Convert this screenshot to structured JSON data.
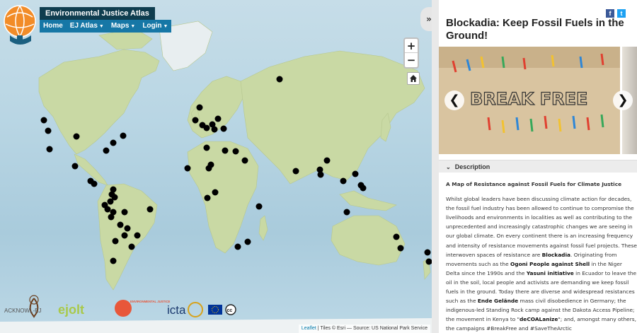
{
  "app": {
    "title": "Environmental Justice Atlas",
    "nav": [
      {
        "label": "Home",
        "caret": false
      },
      {
        "label": "EJ Atlas",
        "caret": true
      },
      {
        "label": "Maps",
        "caret": true
      },
      {
        "label": "Login",
        "caret": true
      }
    ]
  },
  "map": {
    "zoom_in": "+",
    "zoom_out": "−",
    "attribution_link": "Leaflet",
    "attribution_text": " | Tiles © Esri — Source: US National Park Service",
    "ocean_color": "#b9d6e4",
    "land_color": "#c9d9a4",
    "marker_color": "#000000"
  },
  "partners": {
    "labels": [
      "ACKNOWL-EJ",
      "ejolt",
      "ENVIRONMENTAL JUSTICE",
      "icta"
    ]
  },
  "sidebar": {
    "title": "Blockadia: Keep Fossil Fuels in the Ground!",
    "share": [
      "f",
      "t"
    ],
    "slide_text": "BREAK FREE",
    "description_header": "Description",
    "desc_heading": "A Map of Resistance against Fossil Fuels for Climate Justice",
    "p1": "Whilst global leaders have been discussing climate action for decades, the fossil fuel industry has been allowed to continue to compromise the livelihoods and environments in localities as well as contributing to the unprecedented and increasingly catastrophic changes we are seeing in our global climate. On every continent there is an increasing frequency and intensity of resistance movements against fossil fuel projects. These interwoven spaces of resistance are ",
    "b1": "Blockadia",
    "p2": ". Originating from movements such as the ",
    "b2": "Ogoni People against Shell",
    "p3": " in the Niger Delta since the 1990s and the ",
    "b3": "Yasuni initiative",
    "p4": " in Ecuador to leave the oil in the soil, local people and activists are demanding we keep fossil fuels in the ground. Today there are diverse and widespread resistances such as the ",
    "b4": "Ende Gelände",
    "p5": " mass civil disobedience in Germany; the indigenous-led Standing Rock camp against the Dakota Access Pipeline; the movement in Kenya to \"",
    "b5": "deCOALanize",
    "p6": "\"; and, amongst many others, the campaigns #BreakFree and #SaveTheArctic"
  }
}
